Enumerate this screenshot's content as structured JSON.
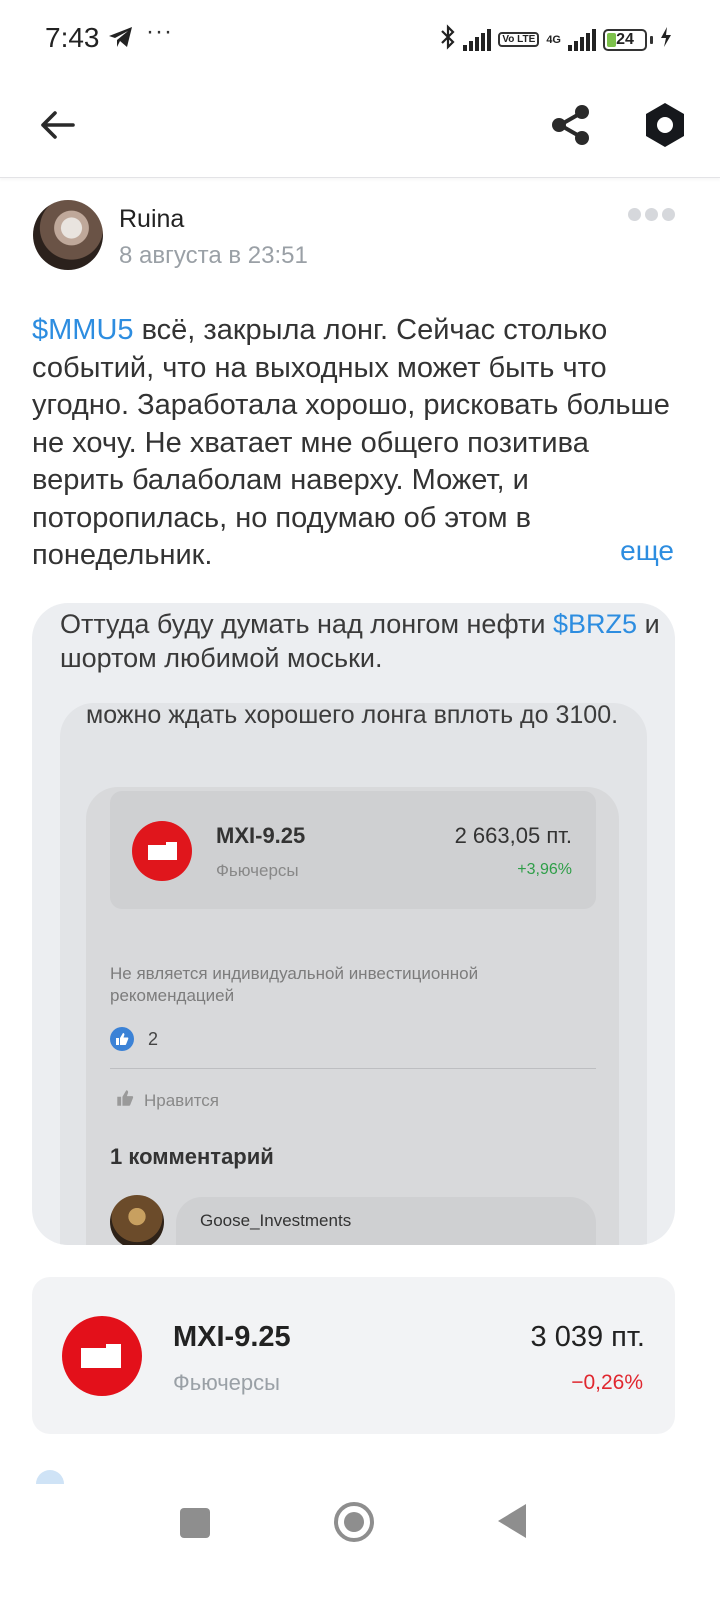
{
  "status_bar": {
    "time": "7:43",
    "dots": "···",
    "battery_level": "24",
    "battery_fraction": 0.24,
    "network": "4G",
    "volte": "Vo LTE"
  },
  "post": {
    "author": "Ruina",
    "date": "8 августа в 23:51",
    "ticker": "$MMU5",
    "text": " всё, закрыла лонг. Сейчас столько событий, что на выходных может быть что угодно. Заработала хорошо, рисковать больше не хочу. Не хватает мне общего позитива верить балаболам наверху. Может, и поторопилась, но подумаю об этом в понедельник.",
    "read_more": "еще"
  },
  "attachment": {
    "line1_before": "Оттуда буду думать над лонгом нефти ",
    "line1_ticker": "$BRZ5",
    "line1_after": " и шортом любимой моськи.",
    "line2": "можно ждать хорошего лонга вплоть до 3100.",
    "quote": {
      "name": "MXI-9.25",
      "kind": "Фьючерсы",
      "price": "2 663,05  пт.",
      "change": "+3,96%"
    },
    "disclaimer": "Не является индивидуальной инвестиционной рекомендацией",
    "likes_count": "2",
    "like_action": "Нравится",
    "comments_title": "1 комментарий",
    "comment_author": "Goose_Investments"
  },
  "instrument": {
    "name": "MXI-9.25",
    "kind": "Фьючерсы",
    "price": "3 039  пт.",
    "change": "−0,26%"
  },
  "colors": {
    "accent": "#2d8de0",
    "brand_red": "#e3101a",
    "negative": "#e0272f",
    "positive": "#2e9e48"
  },
  "icons": [
    "telegram-icon",
    "bluetooth-icon",
    "back-arrow-icon",
    "share-icon",
    "brand-hexagon-icon",
    "more-dots-icon",
    "like-icon"
  ]
}
